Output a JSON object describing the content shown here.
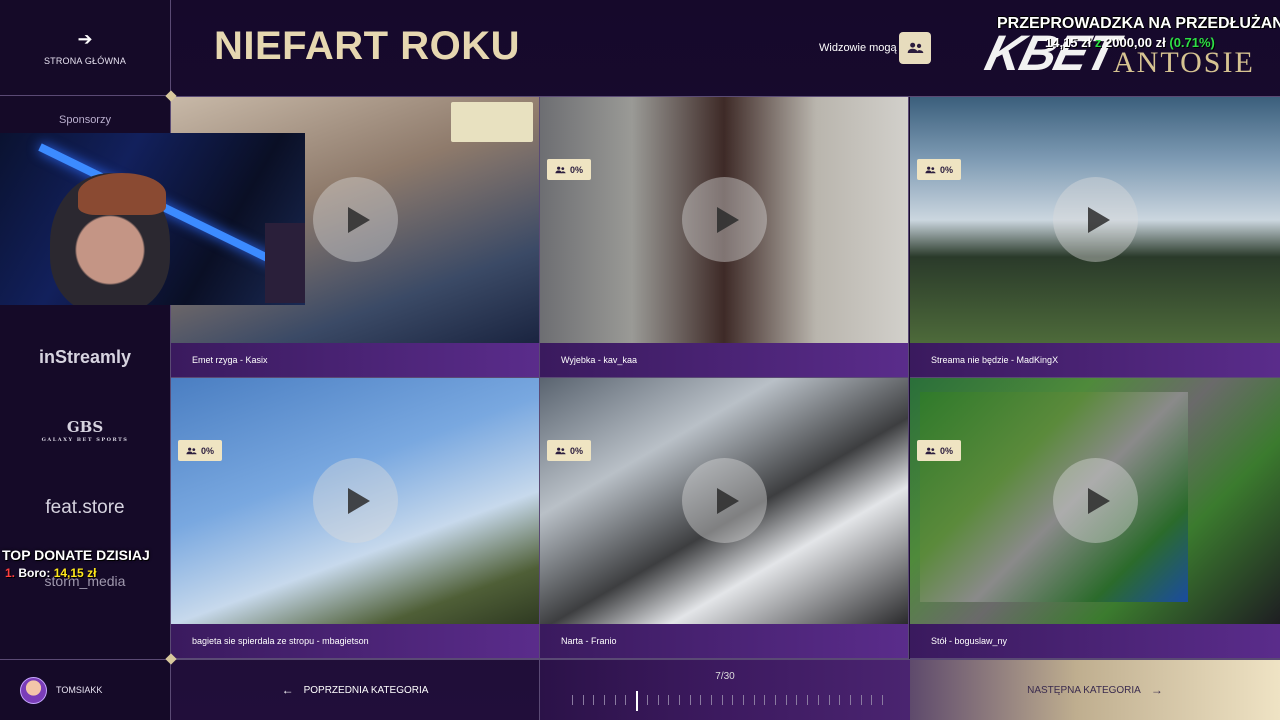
{
  "sidebar": {
    "home_label": "STRONA GŁÓWNA",
    "home_icon": "arrow-left-icon",
    "sponsors_title": "Sponsorzy",
    "sponsors": [
      "inStreamly",
      "GBS",
      "feat.store",
      "storm_media"
    ],
    "gbs_sub": "GALAXY BET SPORTS"
  },
  "donate": {
    "title": "TOP DONATE DZISIAJ",
    "rank": "1.",
    "user": "Boro",
    "amount": "14,15 zł"
  },
  "user": {
    "name": "TOMSIAKK"
  },
  "header": {
    "title": "NIEFART ROKU",
    "viewers_label": "Widzowie mogą",
    "viewers_icon": "users-icon"
  },
  "overlay": {
    "brand": "KBET",
    "brand2": "ANTOSIE",
    "move_text": "PRZEPROWADZKA NA PRZEDŁUŻANY",
    "goal_current": "14,15 zł",
    "goal_sep": "z",
    "goal_total": "2000,00 zł",
    "goal_percent": "(0.71%)"
  },
  "tiles": [
    {
      "caption": "Emet rzyga - Kasix",
      "badge": ""
    },
    {
      "caption": "Wyjebka - kav_kaa",
      "badge": "0%"
    },
    {
      "caption": "Streama nie będzie - MadKingX",
      "badge": "0%"
    },
    {
      "caption": "bagieta sie spierdala ze stropu - mbagietson",
      "badge": "0%"
    },
    {
      "caption": "Narta - Franio",
      "badge": "0%"
    },
    {
      "caption": "Stół - boguslaw_ny",
      "badge": "0%"
    }
  ],
  "footer": {
    "prev_label": "POPRZEDNIA KATEGORIA",
    "next_label": "NASTĘPNA KATEGORIA",
    "page_counter": "7/30",
    "current_page": 7,
    "total_pages": 30
  },
  "colors": {
    "accent_gold": "#e6d7b0",
    "badge_bg": "#efe4c2",
    "goal_green": "#2ddf45",
    "donate_yellow": "#ffe81a"
  }
}
